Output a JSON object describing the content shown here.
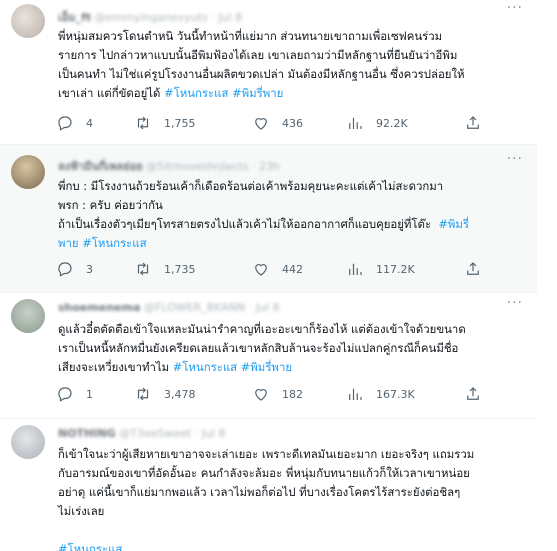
{
  "tweets": [
    {
      "author": "เอ็ม_ft",
      "handle": "@emmyinganevyuts",
      "time": "Jul 8",
      "text": "พี่หนุ่มสมควรโดนตำหนิ วันนี้ทำหน้าที่แย่มาก ส่วนทนายเขาถามเพื่อเซฟคนร่วม\nรายการ ไปกล่าวหาแบบนั้นอีพิมฟ้องได้เลย เขาเลยถามว่ามีหลักฐานที่ยืนยันว่าอีพิม\nเป็นคนทำ ไม่ใช่แค่รูปโรงงานอื่นผลิตขวดเปล่า มันต้องมีหลักฐานอื่น ซึ่งควรปล่อยให้\nเขาเล่า แต่กี่ขัดอยู่ได้ ",
      "tags": "#โหนกระแส #พิมรี่พาย",
      "stats": {
        "replies": "4",
        "retweets": "1,755",
        "likes": "436",
        "views": "92.2K"
      }
    },
    {
      "author": "ลงฟ้ามีนกี่เพลย่อย",
      "handle": "@5itmoveshrjlects",
      "time": "23h",
      "text": "พี่กบ : มีโรงงานถ้วยร้อนเค้าก็เดือดร้อนต่อเค้าพร้อมคุยนะคะแต่เค้าไม่สะดวกมา\nพรก : ครับ ค่อยว่ากัน\nถ้าเป็นเรื่องตัวๆเมียๆโทรสายตรงไปแล้วเค้าไม่ให้ออกอากาศก็แอบคุยอยู่ที่โต๊ะ  ",
      "tags": "#พิมรี่\nพาย #โหนกระแส",
      "stats": {
        "replies": "3",
        "retweets": "1,735",
        "likes": "442",
        "views": "117.2K"
      }
    },
    {
      "author": "shoemenema",
      "handle": "@FLOWER_BKANN",
      "time": "Jul 8",
      "text": "ดูแล้วอี๋ตตัดตือเข้าใจแหละมันน่ารำคาญที่เอะอะเขาก็ร้องไห้ แต่ต้องเข้าใจด้วยขนาด\nเราเป็นหนี้หลักหมื่นยังเครียดเลยแล้วเขาหลักสิบล้านจะร้องไม่แปลกคู่กรณีก็คนมีชื่อ\nเสียงจะเหวี่ยงเขาทำไม ",
      "tags": "#โหนกระแส #พิมรี่พาย",
      "stats": {
        "replies": "1",
        "retweets": "3,478",
        "likes": "182",
        "views": "167.3K"
      }
    },
    {
      "author": "NOTHING",
      "handle": "@T3eeSweet",
      "time": "Jul 8",
      "text": "ก็เข้าใจนะว่าผู้เสียหายเขาอาจจะเล่าเยอะ เพราะดีเทลมันเยอะมาก เยอะจริงๆ แถมรวม\nกับอารมณ์ของเขาที่อัดอั้นอะ คนกำลังจะล้มอะ พี่หนุ่มกับทนายแก้วก็ให้เวลาเขาหน่อย\nอย่าดุ แค่นี้เขาก็แย่มากพอแล้ว เวลาไม่พอก็ต่อไป ที่บางเรื่องโคตรไร้สาระยังต่อชิลๆ\nไม่เร่งเลย\n\n",
      "tags": "#โหนกระแส"
    }
  ]
}
